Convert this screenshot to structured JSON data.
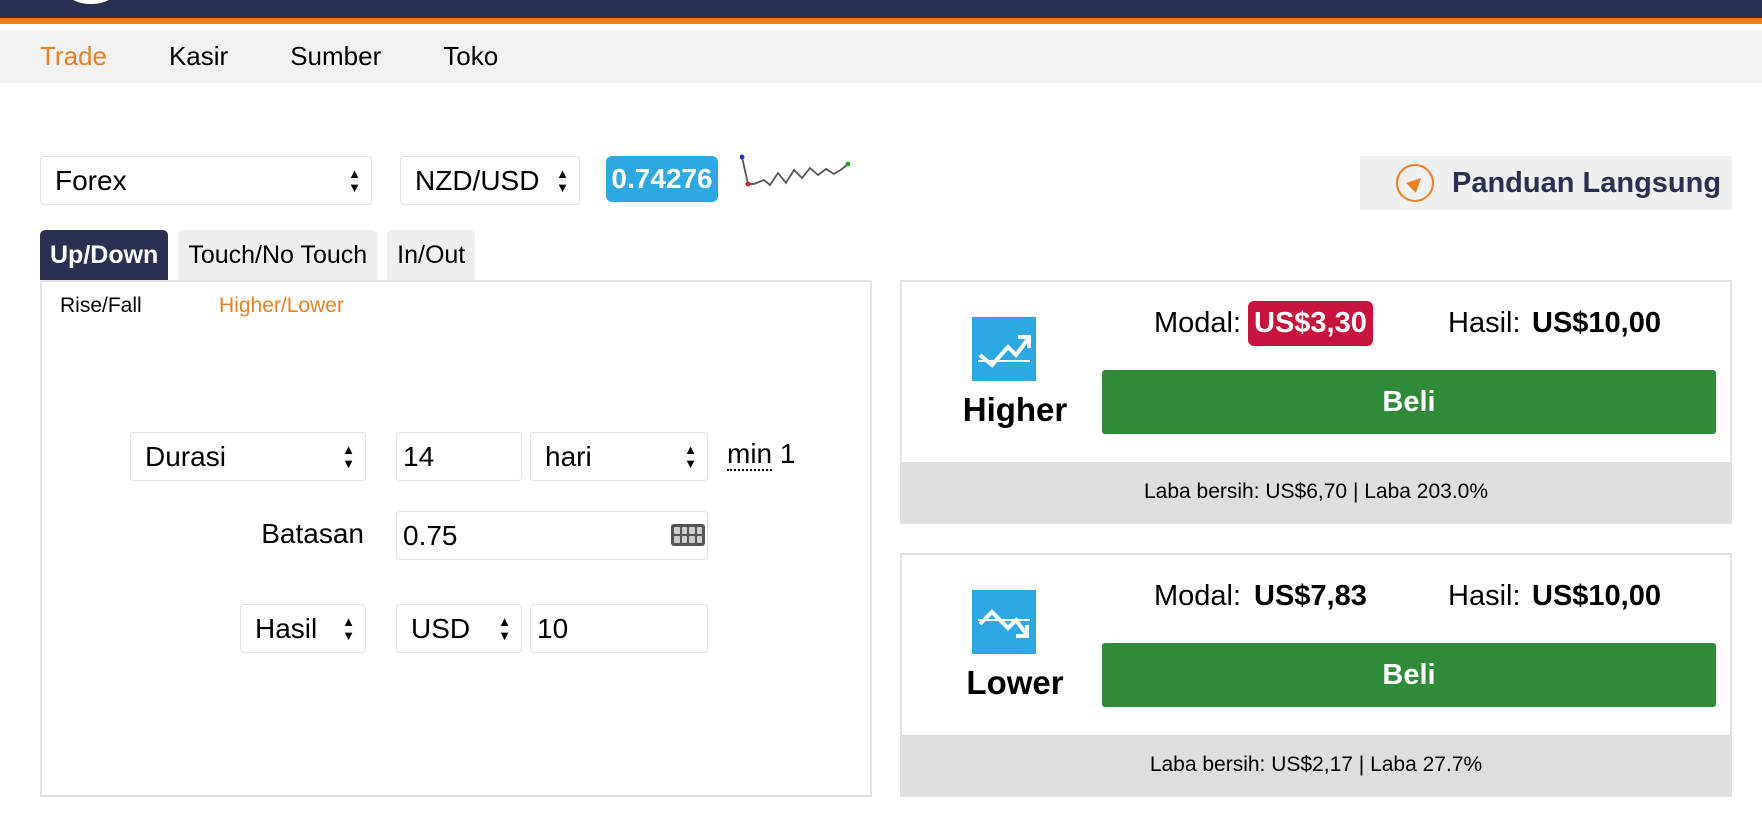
{
  "nav": {
    "items": [
      {
        "label": "Trade",
        "active": true
      },
      {
        "label": "Kasir",
        "active": false
      },
      {
        "label": "Sumber",
        "active": false
      },
      {
        "label": "Toko",
        "active": false
      }
    ]
  },
  "market": {
    "category": "Forex",
    "symbol": "NZD/USD",
    "price": "0.74276"
  },
  "guide": {
    "label": "Panduan Langsung"
  },
  "tabs": [
    {
      "label": "Up/Down",
      "active": true
    },
    {
      "label": "Touch/No Touch",
      "active": false
    },
    {
      "label": "In/Out",
      "active": false
    }
  ],
  "subtabs": [
    {
      "label": "Rise/Fall",
      "active": false
    },
    {
      "label": "Higher/Lower",
      "active": true
    }
  ],
  "form": {
    "duration_type": "Durasi",
    "duration_value": "14",
    "duration_unit": "hari",
    "min_label": "min",
    "min_value": "1",
    "barrier_label": "Batasan",
    "barrier_value": "0.75",
    "basis": "Hasil",
    "currency": "USD",
    "amount": "10"
  },
  "contracts": {
    "higher": {
      "label": "Higher",
      "stake_label": "Modal:",
      "stake_value": "US$3,30",
      "payout_label": "Hasil:",
      "payout_value": "US$10,00",
      "buy_label": "Beli",
      "profit_text": "Laba bersih: US$6,70 | Laba 203.0%"
    },
    "lower": {
      "label": "Lower",
      "stake_label": "Modal:",
      "stake_value": "US$7,83",
      "payout_label": "Hasil:",
      "payout_value": "US$10,00",
      "buy_label": "Beli",
      "profit_text": "Laba bersih: US$2,17 | Laba 27.7%"
    }
  },
  "colors": {
    "navy": "#2a3052",
    "orange": "#e98024",
    "blue": "#2ea8e0",
    "green": "#2f8b37",
    "red": "#c8133d"
  }
}
